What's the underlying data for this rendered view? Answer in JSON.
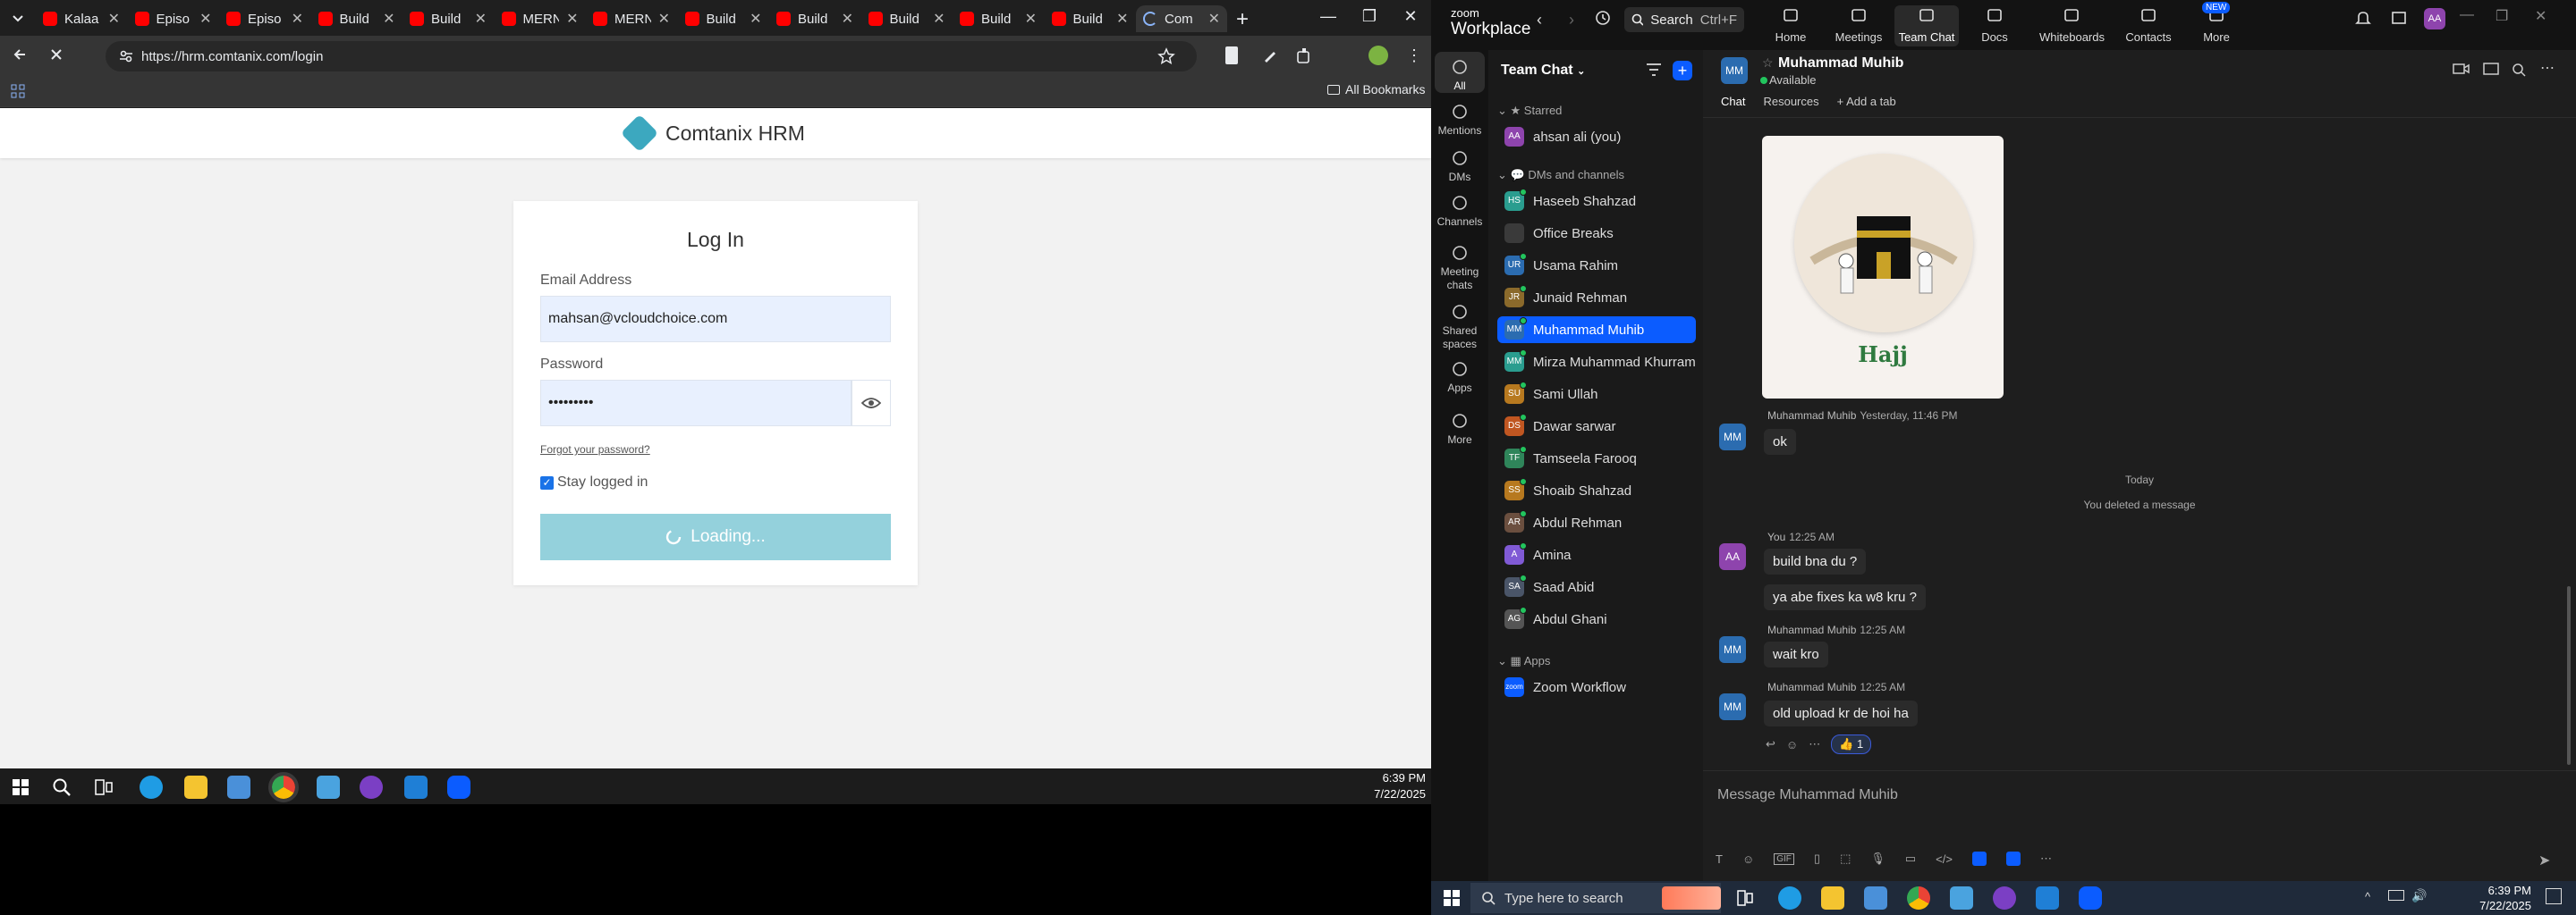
{
  "chrome": {
    "tabs": [
      {
        "title": "Kalaa",
        "icon": "youtube"
      },
      {
        "title": "Episo",
        "icon": "youtube"
      },
      {
        "title": "Episo",
        "icon": "youtube"
      },
      {
        "title": "Build",
        "icon": "youtube"
      },
      {
        "title": "Build",
        "icon": "youtube"
      },
      {
        "title": "MERN",
        "icon": "youtube"
      },
      {
        "title": "MERN",
        "icon": "youtube"
      },
      {
        "title": "Build",
        "icon": "youtube"
      },
      {
        "title": "Build",
        "icon": "youtube"
      },
      {
        "title": "Build",
        "icon": "youtube"
      },
      {
        "title": "Build",
        "icon": "youtube"
      },
      {
        "title": "Build",
        "icon": "youtube"
      },
      {
        "title": "Com",
        "icon": "loading",
        "active": true
      }
    ],
    "url": "https://hrm.comtanix.com/login",
    "all_bookmarks": "All Bookmarks"
  },
  "hrm": {
    "brand": "Comtanix HRM",
    "login_title": "Log In",
    "email_label": "Email Address",
    "email_value": "mahsan@vcloudchoice.com",
    "password_label": "Password",
    "password_value": "•••••••••",
    "forgot": "Forgot your password?",
    "stay_logged": "Stay logged in",
    "loading": "Loading..."
  },
  "taskbar_left": {
    "time": "6:39 PM",
    "date": "7/22/2025"
  },
  "zoom": {
    "logo_top": "zoom",
    "logo_bottom": "Workplace",
    "search": "Search",
    "search_shortcut": "Ctrl+F",
    "nav": [
      "Home",
      "Meetings",
      "Team Chat",
      "Docs",
      "Whiteboards",
      "Contacts",
      "More"
    ],
    "new_badge": "NEW",
    "avatar": "AA",
    "rail": [
      "All",
      "Mentions",
      "DMs",
      "Channels",
      "Meeting chats",
      "Shared spaces",
      "Apps",
      "More"
    ],
    "team_chat": "Team Chat",
    "starred": "Starred",
    "self": {
      "initials": "AA",
      "name": "ahsan ali (you)"
    },
    "dms_header": "DMs and channels",
    "contacts": [
      {
        "initials": "HS",
        "name": "Haseeb Shahzad",
        "color": "#2a9d8f"
      },
      {
        "initials": "",
        "name": "Office Breaks",
        "color": "#3a3a3a"
      },
      {
        "initials": "UR",
        "name": "Usama Rahim",
        "color": "#2b6cb0"
      },
      {
        "initials": "JR",
        "name": "Junaid Rehman",
        "color": "#8b6a2b"
      },
      {
        "initials": "MM",
        "name": "Muhammad Muhib",
        "color": "#2b6cb0",
        "active": true
      },
      {
        "initials": "MM",
        "name": "Mirza Muhammad Khurram",
        "color": "#2a9d8f"
      },
      {
        "initials": "SU",
        "name": "Sami Ullah",
        "color": "#b7791f"
      },
      {
        "initials": "DS",
        "name": "Dawar sarwar",
        "color": "#c05621"
      },
      {
        "initials": "TF",
        "name": "Tamseela Farooq",
        "color": "#2f855a"
      },
      {
        "initials": "SS",
        "name": "Shoaib Shahzad",
        "color": "#b7791f"
      },
      {
        "initials": "AR",
        "name": "Abdul Rehman",
        "color": "#6b4f3f"
      },
      {
        "initials": "A",
        "name": "Amina",
        "color": "#805ad5"
      },
      {
        "initials": "SA",
        "name": "Saad Abid",
        "color": "#4a5568"
      },
      {
        "initials": "AG",
        "name": "Abdul Ghani",
        "color": "#555"
      }
    ],
    "apps_header": "Apps",
    "app_item": {
      "initials": "zoom",
      "name": "Zoom Workflow"
    },
    "chat": {
      "avatar": "MM",
      "name": "Muhammad Muhib",
      "status": "Available",
      "tabs": [
        "Chat",
        "Resources",
        "+ Add a tab"
      ],
      "image_caption": "Hajj",
      "messages": [
        {
          "sender": "Muhammad Muhib",
          "time": "Yesterday, 11:46 PM",
          "text": "ok",
          "avatar": "MM"
        },
        {
          "system": "Today"
        },
        {
          "system": "You deleted a message"
        },
        {
          "sender": "You",
          "time": "12:25 AM",
          "text": "build bna du  ?",
          "avatar": "AA"
        },
        {
          "text": "ya abe fixes ka w8 kru ?"
        },
        {
          "sender": "Muhammad Muhib",
          "time": "12:25 AM",
          "text": "wait kro",
          "avatar": "MM"
        },
        {
          "sender": "Muhammad Muhib",
          "time": "12:25 AM",
          "text": "old upload kr de hoi ha",
          "avatar": "MM"
        }
      ],
      "reaction": "👍 1",
      "composer_placeholder": "Message Muhammad Muhib"
    }
  },
  "taskbar_right": {
    "search": "Type here to search",
    "time": "6:39 PM",
    "date": "7/22/2025"
  }
}
